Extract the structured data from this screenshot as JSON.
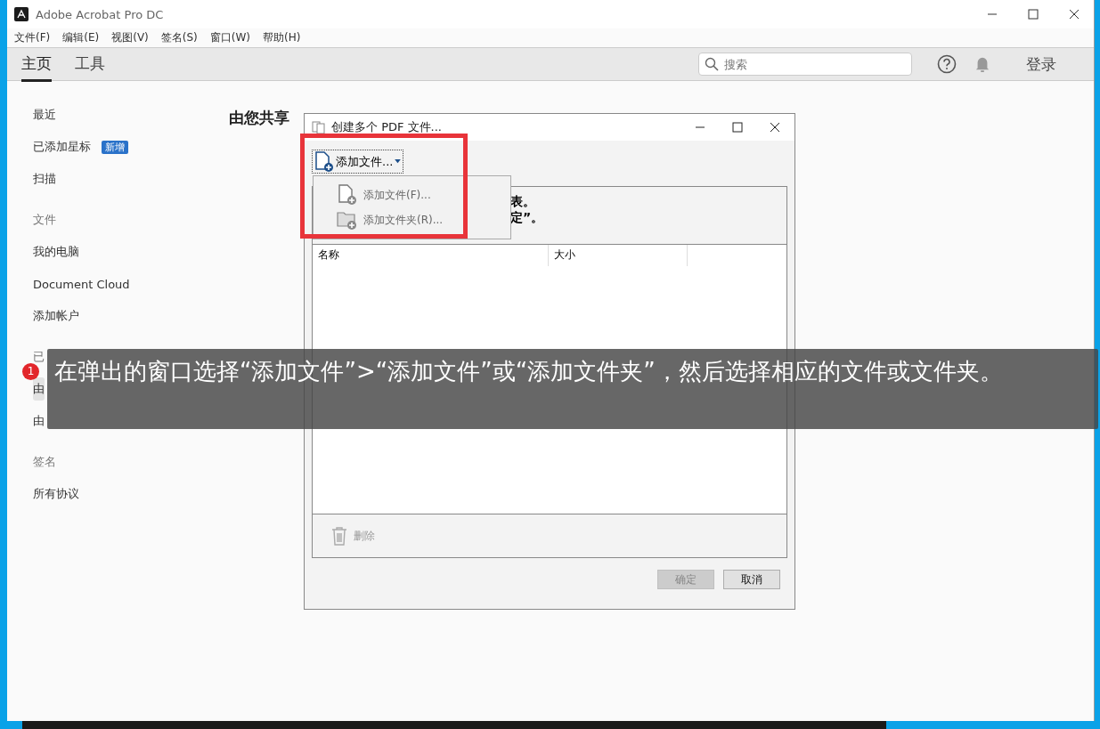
{
  "window": {
    "title": "Adobe Acrobat Pro DC"
  },
  "menu_bar": [
    "文件(F)",
    "编辑(E)",
    "视图(V)",
    "签名(S)",
    "窗口(W)",
    "帮助(H)"
  ],
  "tabs": [
    {
      "label": "主页",
      "selected": true
    },
    {
      "label": "工具",
      "selected": false
    }
  ],
  "search": {
    "placeholder": "搜索"
  },
  "sign_in": "登录",
  "sidebar": {
    "items": [
      {
        "kind": "item",
        "label": "最近",
        "selected": false
      },
      {
        "kind": "item",
        "label": "已添加星标",
        "badge": "新增",
        "selected": false
      },
      {
        "kind": "item",
        "label": "扫描",
        "selected": false
      },
      {
        "kind": "section",
        "label": "文件"
      },
      {
        "kind": "item",
        "label": "我的电脑",
        "selected": false
      },
      {
        "kind": "item",
        "label": "Document Cloud",
        "selected": false
      },
      {
        "kind": "item",
        "label": "添加帐户",
        "selected": false
      },
      {
        "kind": "section",
        "label": "已"
      },
      {
        "kind": "item",
        "label": "由",
        "selected": true
      },
      {
        "kind": "item",
        "label": "由",
        "selected": false
      },
      {
        "kind": "section",
        "label": "签名"
      },
      {
        "kind": "item",
        "label": "所有协议",
        "selected": false
      }
    ]
  },
  "heading": "由您共享",
  "dialog": {
    "title": "创建多个 PDF 文件...",
    "add_button": "添加文件...",
    "menu": [
      {
        "kind": "file",
        "label": "添加文件(F)..."
      },
      {
        "kind": "folder",
        "label": "添加文件夹(R)..."
      }
    ],
    "info_lines": [
      "表。",
      "定”。"
    ],
    "columns": [
      "名称",
      "大小"
    ],
    "delete_button": {
      "label": "删除",
      "disabled": true
    },
    "buttons": [
      {
        "label": "确定",
        "disabled": true
      },
      {
        "label": "取消",
        "disabled": false
      }
    ]
  },
  "callout": {
    "step": "1",
    "text": "在弹出的窗口选择“添加文件”>“添加文件”或“添加文件夹”，然后选择相应的文件或文件夹。"
  }
}
